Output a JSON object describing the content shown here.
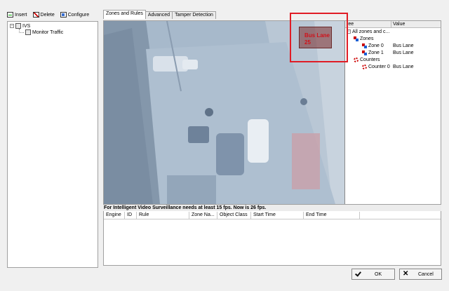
{
  "toolbar": {
    "insert_label": "Insert",
    "delete_label": "Delete",
    "configure_label": "Configure"
  },
  "tree": {
    "root_label": "IVS",
    "child_label": "Monitor Traffic"
  },
  "tabs": [
    {
      "label": "Zones and Rules",
      "active": true
    },
    {
      "label": "Advanced",
      "active": false
    },
    {
      "label": "Tamper Detection",
      "active": false
    }
  ],
  "video_overlay": {
    "zone_label": "Bus Lane",
    "counter_value": "25"
  },
  "property_grid": {
    "header_tree": "ree",
    "header_value": "Value",
    "rows": [
      {
        "name": "All zones and c...",
        "value": ""
      },
      {
        "name": "Zones",
        "value": ""
      },
      {
        "name": "Zone 0",
        "value": "Bus Lane"
      },
      {
        "name": "Zone 1",
        "value": "Bus Lane"
      },
      {
        "name": "Counters",
        "value": ""
      },
      {
        "name": "Counter 0",
        "value": "Bus Lane"
      }
    ]
  },
  "status": {
    "fps_message": "For Intelligent Video Surveillance needs at least 15 fps. Now is 26 fps."
  },
  "event_table": {
    "columns": [
      "Engine",
      "ID",
      "Rule",
      "Zone Na...",
      "Object Class",
      "Start Time",
      "End Time"
    ]
  },
  "buttons": {
    "ok_label": "OK",
    "cancel_label": "Cancel"
  },
  "colors": {
    "highlight": "#e01c25",
    "overlay_text": "#d0121a"
  }
}
